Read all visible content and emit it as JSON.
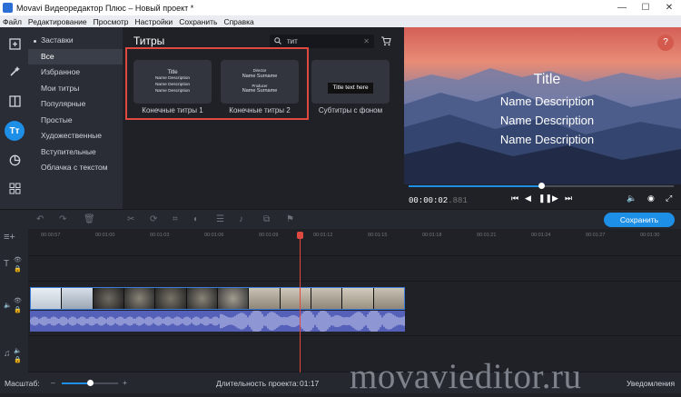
{
  "app": {
    "window_title": "Movavi Видеоредактор Плюс – Новый проект *"
  },
  "menu": [
    "Файл",
    "Редактирование",
    "Просмотр",
    "Настройки",
    "Сохранить",
    "Справка"
  ],
  "categories": [
    {
      "label": "Заставки"
    },
    {
      "label": "Все"
    },
    {
      "label": "Избранное"
    },
    {
      "label": "Мои титры"
    },
    {
      "label": "Популярные"
    },
    {
      "label": "Простые"
    },
    {
      "label": "Художественные"
    },
    {
      "label": "Вступительные"
    },
    {
      "label": "Облачка с текстом"
    }
  ],
  "panel": {
    "title": "Титры",
    "search_value": "тит",
    "items": [
      {
        "label": "Конечные титры 1",
        "lines": [
          "Title",
          "Name Description",
          "Name Description",
          "Name Description"
        ]
      },
      {
        "label": "Конечные титры 2",
        "lines": [
          "Director",
          "Name Surname",
          "Producer",
          "Name Surname"
        ]
      },
      {
        "label": "Субтитры с фоном",
        "lines": [
          "Title text here"
        ]
      }
    ]
  },
  "preview": {
    "lines": [
      "Title",
      "Name Description",
      "Name Description",
      "Name Description"
    ],
    "help": "?",
    "time_main": "00:00:02",
    "time_ms": ".881",
    "progress": 0.5
  },
  "toolbar": {
    "save_label": "Сохранить"
  },
  "ruler": [
    "00:00:57",
    "00:01:00",
    "00:01:03",
    "00:01:06",
    "00:01:09",
    "00:01:12",
    "00:01:15",
    "00:01:18",
    "00:01:21",
    "00:01:24",
    "00:01:27",
    "00:01:30"
  ],
  "status": {
    "scale_label": "Масштаб:",
    "duration_label": "Длительность проекта:",
    "duration_value": "01:17",
    "notifications": "Уведомления"
  },
  "watermark": "movavieditor.ru",
  "colors": {
    "accent": "#1e8fe6",
    "highlight": "#e0493f",
    "bg": "#1f2127"
  }
}
